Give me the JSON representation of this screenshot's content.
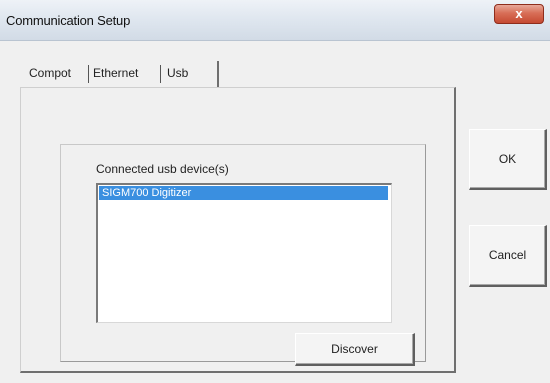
{
  "window": {
    "title": "Communication Setup",
    "close_glyph": "x"
  },
  "tabs": [
    {
      "label": "Compot",
      "selected": false
    },
    {
      "label": "Ethernet",
      "selected": false
    },
    {
      "label": "Usb",
      "selected": true
    }
  ],
  "usb_page": {
    "group_label": "Connected usb device(s)",
    "devices": [
      {
        "name": "SIGM700 Digitizer",
        "selected": true
      }
    ],
    "discover_label": "Discover"
  },
  "buttons": {
    "ok_label": "OK",
    "cancel_label": "Cancel"
  },
  "colors": {
    "selection": "#3a8fe0",
    "close_button": "#c54a32"
  }
}
